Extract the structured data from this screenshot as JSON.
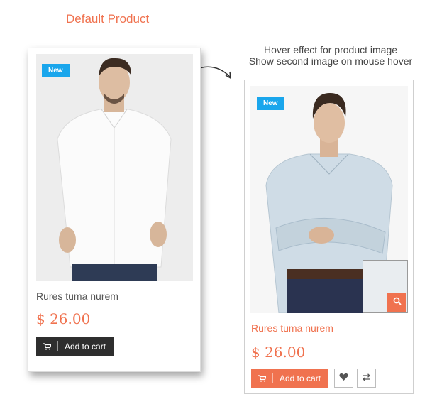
{
  "headings": {
    "default": "Default Product",
    "hover_line1": "Hover effect for product image",
    "hover_line2": "Show second image on mouse hover"
  },
  "default_product": {
    "badge": "New",
    "title": "Rures tuma nurem",
    "price": "$ 26.00",
    "add_to_cart": "Add to cart"
  },
  "hover_product": {
    "badge": "New",
    "title": "Rures tuma nurem",
    "price": "$ 26.00",
    "add_to_cart": "Add to cart",
    "actions": [
      "heart-icon",
      "compare-icon",
      "search-icon"
    ]
  },
  "colors": {
    "accent": "#f0724f",
    "badge": "#1aa6ec",
    "dark_button": "#2e2e2e"
  }
}
